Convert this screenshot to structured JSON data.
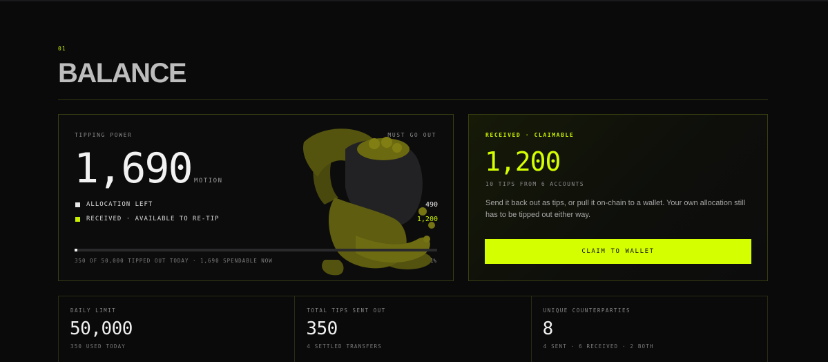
{
  "section": {
    "number": "01",
    "title": "BALANCE"
  },
  "power": {
    "label": "TIPPING POWER",
    "must_go_out": "MUST GO OUT",
    "value": "1,690",
    "unit": "MOTION",
    "rows": [
      {
        "label": "ALLOCATION LEFT",
        "value": "490"
      },
      {
        "label": "RECEIVED · AVAILABLE TO RE-TIP",
        "value": "1,200"
      }
    ],
    "progress_fraction": 0.007,
    "footer": "350 OF 50,000 TIPPED OUT TODAY · 1,690 SPENDABLE NOW",
    "percent": "1%",
    "mascot_icon": "coin-sack-mascot-icon"
  },
  "claim": {
    "label": "RECEIVED · CLAIMABLE",
    "value": "1,200",
    "sub": "10 TIPS FROM 6 ACCOUNTS",
    "description": "Send it back out as tips, or pull it on-chain to a wallet. Your own allocation still has to be tipped out either way.",
    "button_label": "CLAIM TO WALLET"
  },
  "stats": [
    {
      "label": "DAILY LIMIT",
      "value": "50,000",
      "sub": "350 USED TODAY"
    },
    {
      "label": "TOTAL TIPS SENT OUT",
      "value": "350",
      "sub": "4 SETTLED TRANSFERS"
    },
    {
      "label": "UNIQUE COUNTERPARTIES",
      "value": "8",
      "sub": "4 SENT · 6 RECEIVED · 2 BOTH"
    }
  ],
  "colors": {
    "accent": "#d4ff00",
    "background": "#0a0a0b",
    "border": "#3a3f12"
  }
}
